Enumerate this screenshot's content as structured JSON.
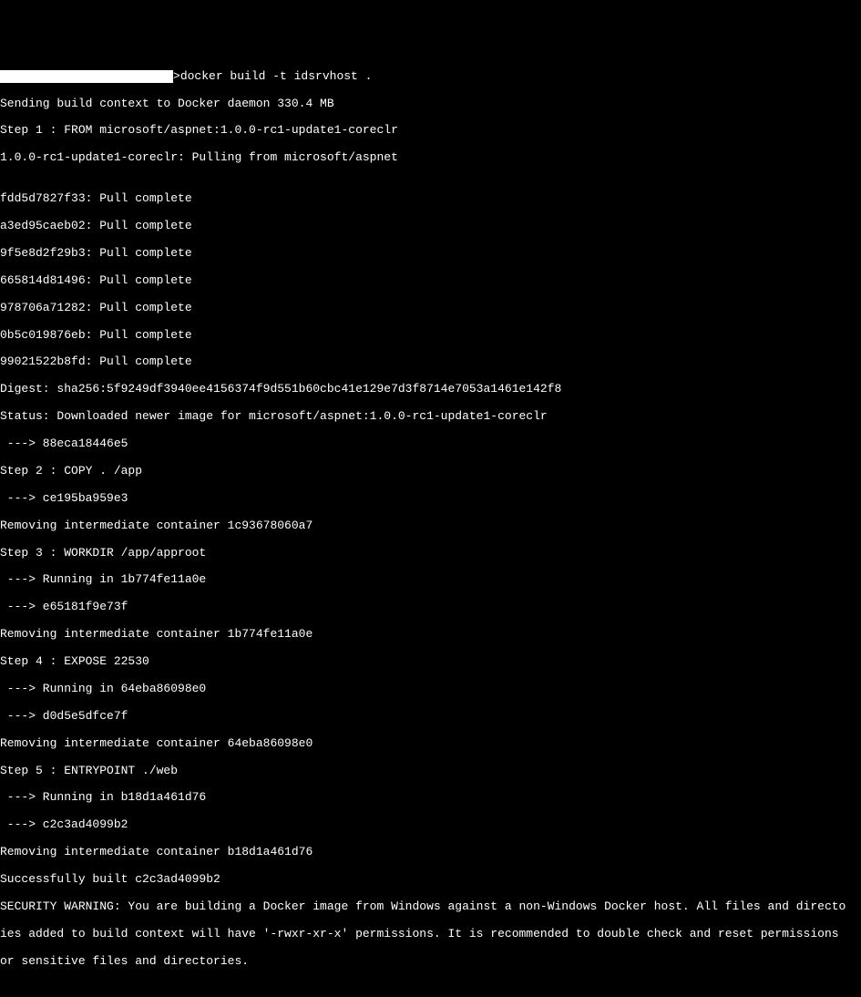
{
  "terminal": {
    "prompt_char": ">",
    "command": "docker build -t idsrvhost .",
    "lines": [
      "Sending build context to Docker daemon 330.4 MB",
      "Step 1 : FROM microsoft/aspnet:1.0.0-rc1-update1-coreclr",
      "1.0.0-rc1-update1-coreclr: Pulling from microsoft/aspnet",
      "",
      "fdd5d7827f33: Pull complete",
      "a3ed95caeb02: Pull complete",
      "9f5e8d2f29b3: Pull complete",
      "665814d81496: Pull complete",
      "978706a71282: Pull complete",
      "0b5c019876eb: Pull complete",
      "99021522b8fd: Pull complete",
      "Digest: sha256:5f9249df3940ee4156374f9d551b60cbc41e129e7d3f8714e7053a1461e142f8",
      "Status: Downloaded newer image for microsoft/aspnet:1.0.0-rc1-update1-coreclr",
      " ---> 88eca18446e5",
      "Step 2 : COPY . /app",
      " ---> ce195ba959e3",
      "Removing intermediate container 1c93678060a7",
      "Step 3 : WORKDIR /app/approot",
      " ---> Running in 1b774fe11a0e",
      " ---> e65181f9e73f",
      "Removing intermediate container 1b774fe11a0e",
      "Step 4 : EXPOSE 22530",
      " ---> Running in 64eba86098e0",
      " ---> d0d5e5dfce7f",
      "Removing intermediate container 64eba86098e0",
      "Step 5 : ENTRYPOINT ./web",
      " ---> Running in b18d1a461d76",
      " ---> c2c3ad4099b2",
      "Removing intermediate container b18d1a461d76",
      "Successfully built c2c3ad4099b2",
      "SECURITY WARNING: You are building a Docker image from Windows against a non-Windows Docker host. All files and directo",
      "ies added to build context will have '-rwxr-xr-x' permissions. It is recommended to double check and reset permissions ",
      "or sensitive files and directories."
    ]
  }
}
